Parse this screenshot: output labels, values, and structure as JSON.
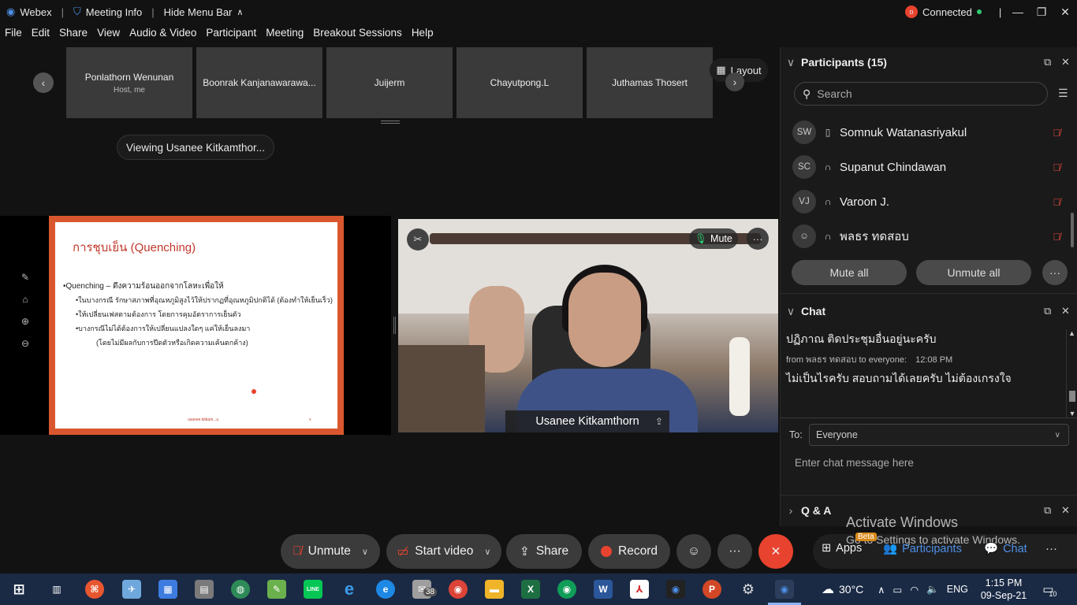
{
  "titlebar": {
    "app": "Webex",
    "meeting_info": "Meeting Info",
    "hide_menu": "Hide Menu Bar",
    "status": "Connected"
  },
  "menu": [
    "File",
    "Edit",
    "Share",
    "View",
    "Audio & Video",
    "Participant",
    "Meeting",
    "Breakout Sessions",
    "Help"
  ],
  "thumbnails": [
    {
      "name": "Ponlathorn Wenunan",
      "sub": "Host, me"
    },
    {
      "name": "Boonrak Kanjanawarawa...",
      "sub": ""
    },
    {
      "name": "Juijerm",
      "sub": ""
    },
    {
      "name": "Chayutpong.L",
      "sub": ""
    },
    {
      "name": "Juthamas Thosert",
      "sub": ""
    }
  ],
  "layout_label": "Layout",
  "viewing_label": "Viewing Usanee Kitkamthor...",
  "slide": {
    "title": "การชุบเย็น (Quenching)",
    "lines": [
      "•Quenching – ดึงความร้อนออกจากโลหะเพื่อให้",
      "•ในบางกรณี รักษาสภาพที่อุณหภูมิสูงไว้ให้ปรากฏที่อุณหภูมิปกติได้ (ต้องทำให้เย็นเร็ว)",
      "•ให้เปลี่ยนเฟสตามต้องการ โดยการคุมอัตราการเย็นตัว",
      "•บางกรณีไม่ได้ต้องการให้เปลี่ยนแปลงใดๆ แค่ให้เย็นลงมา",
      "(โดยไม่มีผลกับการปีดตัวหรือเกิดความเค้นตกค้าง)"
    ],
    "footer_left": "usanee.kitkam...u",
    "footer_right": "v"
  },
  "video": {
    "name": "Usanee Kitkamthorn",
    "mute_label": "Mute"
  },
  "participants": {
    "title": "Participants (15)",
    "search_placeholder": "Search",
    "rows": [
      {
        "initials": "SW",
        "name": "Somnuk Watanasriyakul"
      },
      {
        "initials": "SC",
        "name": "Supanut Chindawan"
      },
      {
        "initials": "VJ",
        "name": "Varoon J."
      },
      {
        "initials": "",
        "name": "พลธร ทดสอบ"
      }
    ],
    "mute_all": "Mute all",
    "unmute_all": "Unmute all"
  },
  "chat": {
    "title": "Chat",
    "msg1": "ปฏิภาณ ติดประชุมอื่นอยู่นะครับ",
    "meta_from": "from พลธร ทดสอบ",
    "meta_to": "to everyone:",
    "meta_time": "12:08 PM",
    "msg2": "ไม่เป็นไรครับ สอบถามได้เลยครับ ไม่ต้องเกรงใจ",
    "to_label": "To:",
    "to_value": "Everyone",
    "input_placeholder": "Enter chat message here"
  },
  "qa_title": "Q & A",
  "toolbar": {
    "unmute": "Unmute",
    "start_video": "Start video",
    "share": "Share",
    "record": "Record",
    "apps": "Apps",
    "apps_badge": "Beta",
    "participants": "Participants",
    "chat": "Chat"
  },
  "activate": {
    "line1": "Activate Windows",
    "line2": "Go to Settings to activate Windows."
  },
  "taskbar": {
    "weather": "30°C",
    "lang": "ENG",
    "time": "1:15 PM",
    "date": "09-Sep-21",
    "mail_badge": "38",
    "notif_count": "10"
  },
  "colors": {
    "accent_blue": "#4d8fe8",
    "hangup_red": "#e8432f",
    "slide_border": "#d9572e",
    "connected_green": "#2ecc71"
  }
}
